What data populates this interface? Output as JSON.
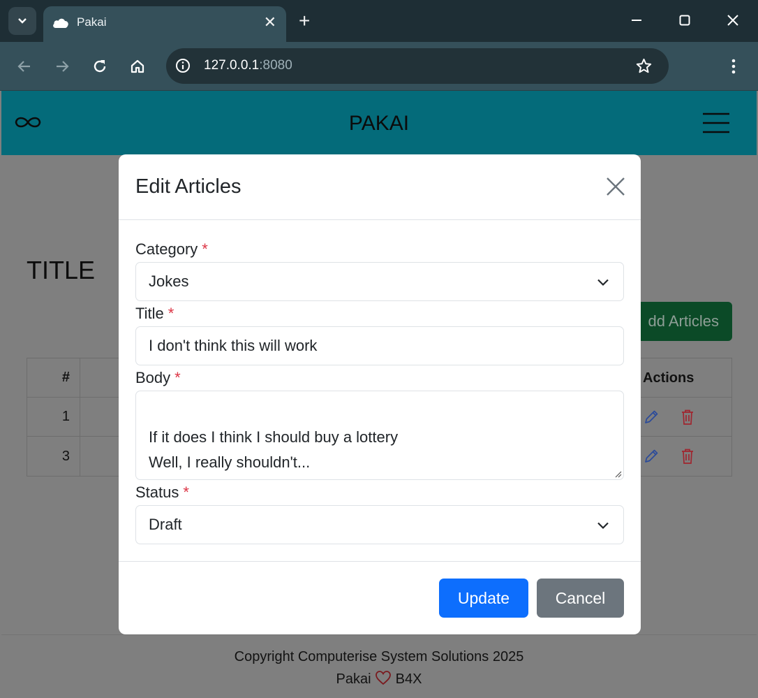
{
  "browser": {
    "tab_title": "Pakai",
    "tab_close": "✕",
    "new_tab": "+",
    "url_host": "127.0.0.1",
    "url_port": ":8080"
  },
  "app": {
    "brand": "PAKAI",
    "page_title": "TITLE",
    "add_button": "dd Articles",
    "table": {
      "col_num": "#",
      "col_actions": "Actions",
      "rows": [
        {
          "num": "1"
        },
        {
          "num": "3"
        }
      ]
    },
    "footer": {
      "line1": "Copyright Computerise System Solutions 2025",
      "line2_left": "Pakai",
      "line2_right": "B4X"
    }
  },
  "modal": {
    "title": "Edit Articles",
    "category": {
      "label": "Category",
      "value": "Jokes"
    },
    "title_field": {
      "label": "Title",
      "value": "I don't think this will work"
    },
    "body": {
      "label": "Body",
      "value": "If it does I think I should buy a lottery\nWell, I really shouldn't..."
    },
    "status": {
      "label": "Status",
      "value": "Draft"
    },
    "required_mark": "*",
    "update_label": "Update",
    "cancel_label": "Cancel"
  },
  "colors": {
    "appbar": "#046b7a",
    "primary": "#0d6efd",
    "secondary": "#6c757d",
    "danger": "#dc3545",
    "success_dimmed": "#0b4a27"
  }
}
